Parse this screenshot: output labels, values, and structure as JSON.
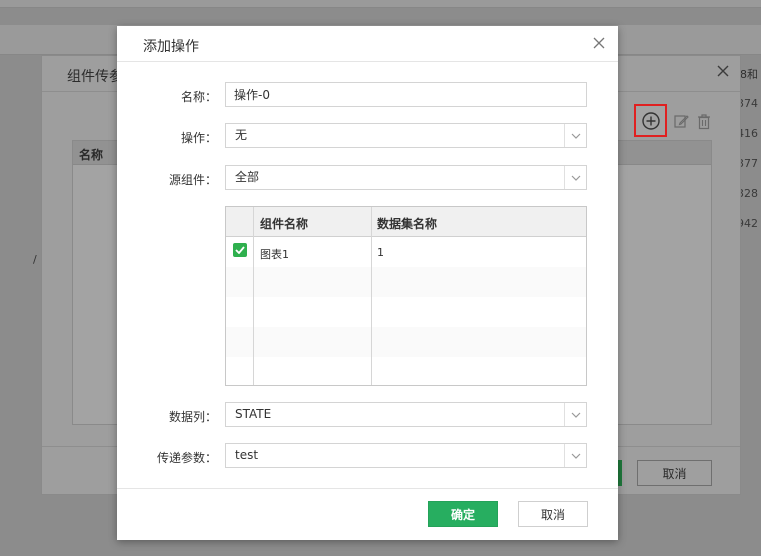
{
  "background": {
    "right_numbers": [
      "374",
      "416",
      "377",
      "328",
      "942"
    ],
    "corner_text": "8和",
    "slash": "/"
  },
  "mid_dialog": {
    "title": "组件传参",
    "table_header": "名称",
    "cancel_label": "取消",
    "tools": [
      "add-circle-icon",
      "edit-icon",
      "trash-icon"
    ]
  },
  "dialog": {
    "title": "添加操作",
    "fields": {
      "name": {
        "label": "名称：",
        "value": "操作-0"
      },
      "action": {
        "label": "操作：",
        "value": "无"
      },
      "source": {
        "label": "源组件：",
        "value": "全部"
      },
      "data_column": {
        "label": "数据列：",
        "value": "STATE"
      },
      "param": {
        "label": "传递参数：",
        "value": "test"
      }
    },
    "grid": {
      "columns": [
        "组件名称",
        "数据集名称"
      ],
      "rows": [
        {
          "checked": true,
          "component": "图表1",
          "dataset": "1"
        }
      ]
    },
    "ok_label": "确定",
    "cancel_label": "取消"
  },
  "colors": {
    "accent": "#27ae60",
    "highlight": "#e02020"
  }
}
